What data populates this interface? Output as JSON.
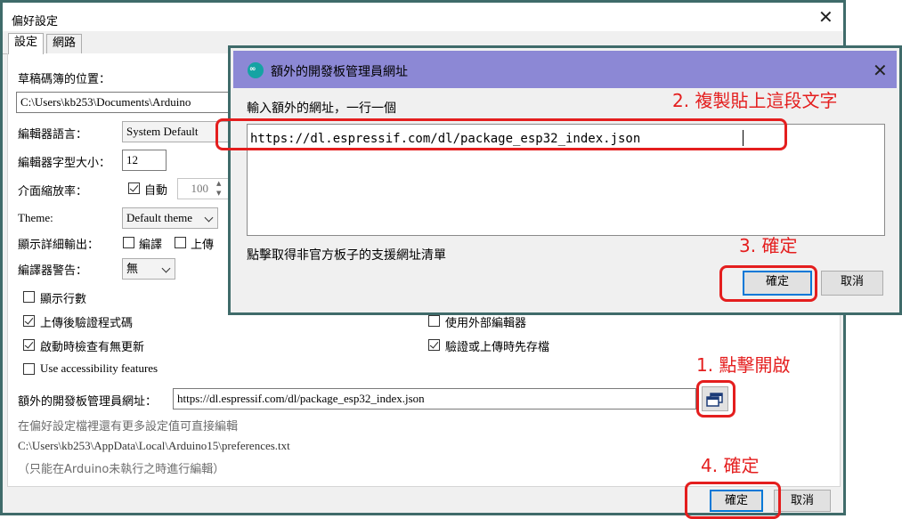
{
  "prefs": {
    "title": "偏好設定",
    "tabs": [
      "設定",
      "網路"
    ],
    "sketchbook_label": "草稿碼簿的位置：",
    "sketchbook_path": "C:\\Users\\kb253\\Documents\\Arduino",
    "editor_language_label": "編輯器語言：",
    "editor_language_value": "System Default",
    "font_size_label": "編輯器字型大小：",
    "font_size_value": "12",
    "zoom_label": "介面縮放率：",
    "zoom_auto_label": "自動",
    "zoom_value": "100",
    "theme_label": "Theme:",
    "theme_value": "Default theme",
    "verbose_label": "顯示詳細輸出：",
    "verbose_compile": "編譯",
    "verbose_upload": "上傳",
    "warnings_label": "編譯器警告：",
    "warnings_value": "無",
    "show_line_numbers": "顯示行數",
    "verify_after_upload": "上傳後驗證程式碼",
    "check_updates": "啟動時檢查有無更新",
    "accessibility": "Use accessibility features",
    "external_editor": "使用外部編輯器",
    "save_before_verify": "驗證或上傳時先存檔",
    "board_urls_label": "額外的開發板管理員網址：",
    "board_urls_value": "https://dl.espressif.com/dl/package_esp32_index.json",
    "more_prefs_note": "在偏好設定檔裡還有更多設定值可直接編輯",
    "prefs_path": "C:\\Users\\kb253\\AppData\\Local\\Arduino15\\preferences.txt",
    "edit_note": "（只能在Arduino未執行之時進行編輯）",
    "ok_label": "確定",
    "cancel_label": "取消"
  },
  "dialog": {
    "title": "額外的開發板管理員網址",
    "instruction": "輸入額外的網址，一行一個",
    "url_text": "https://dl.espressif.com/dl/package_esp32_index.json",
    "link_text": "點擊取得非官方板子的支援網址清單",
    "ok_label": "確定",
    "cancel_label": "取消"
  },
  "annotations": {
    "step1": "1. 點擊開啟",
    "step2": "2. 複製貼上這段文字",
    "step3": "3. 確定",
    "step4": "4. 確定"
  },
  "colors": {
    "annotation_red": "#e41e1e",
    "dialog_titlebar": "#8c88d5",
    "window_border": "#3f6b6a"
  }
}
